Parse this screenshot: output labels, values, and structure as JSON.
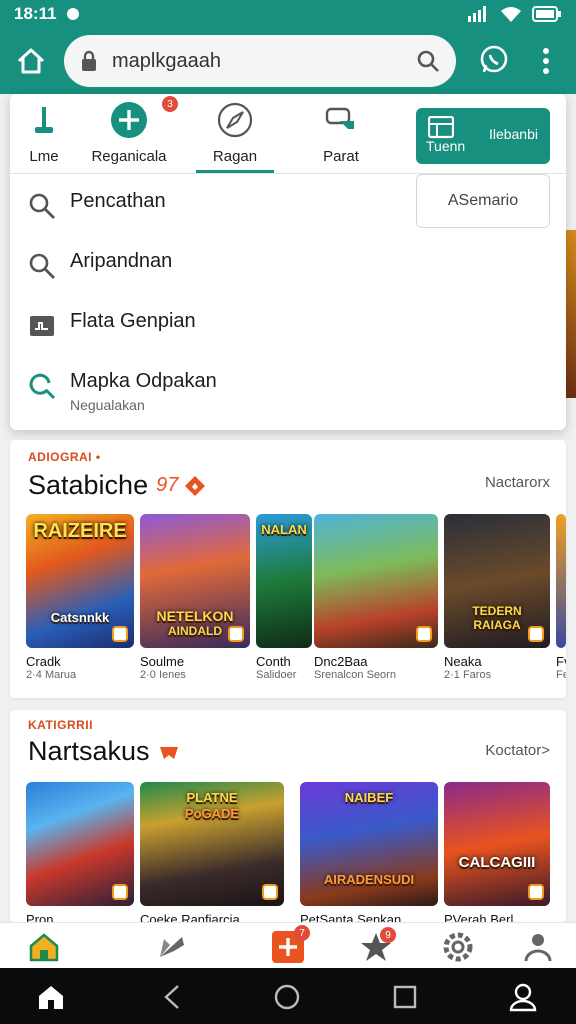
{
  "status": {
    "time": "18:11"
  },
  "url": {
    "value": "maplkgaaah"
  },
  "tabs": [
    {
      "label": "Lme"
    },
    {
      "label": "Reganicala",
      "badge": "3"
    },
    {
      "label": "Ragan"
    },
    {
      "label": "Parat"
    }
  ],
  "theme_button": {
    "left": "Tuenn",
    "right": "Ilebanbi"
  },
  "semario_button": "ASemario",
  "suggestions": [
    {
      "text": "Pencathan",
      "icon": "search-icon"
    },
    {
      "text": "Aripandnan",
      "icon": "search-icon"
    },
    {
      "text": "Flata Genpian",
      "icon": "document-icon"
    },
    {
      "text": "Mapka Odpakan",
      "sub": "Negualakan",
      "icon": "search-refresh-icon"
    }
  ],
  "sections": [
    {
      "kicker": "ADIOGRAI •",
      "title": "Satabiche",
      "title_badge": "97",
      "link": "Nactarorx",
      "cards": [
        {
          "art": "RAIZEIRE",
          "art2": "Catsnnkk",
          "name": "Cradk",
          "meta": "2·4 Marua"
        },
        {
          "art": "NETELKON",
          "art2": "AINDALD",
          "name": "Soulme",
          "meta": "2·0 Ienes"
        },
        {
          "art": "NALAN",
          "art2": "",
          "name": "Conth",
          "meta": "Salidoer"
        },
        {
          "art": "",
          "art2": "",
          "name": "Dnc2Baa",
          "meta": "Srenalcon Seorn"
        },
        {
          "art": "TEDERN",
          "art2": "RAIAGA",
          "name": "Neaka",
          "meta": "2·1 Faros"
        },
        {
          "art": "",
          "art2": "",
          "name": "Fv",
          "meta": "Fe"
        }
      ]
    },
    {
      "kicker": "KATIGRRII",
      "title": "Nartsakus",
      "link": "Koctator>",
      "cards": [
        {
          "art": "",
          "art2": "",
          "name": "Pron",
          "meta": ""
        },
        {
          "art": "PLATNE",
          "art2": "PoGADE",
          "name": "Coeke Ranfiarcia",
          "meta": ""
        },
        {
          "art": "NAIBEF",
          "art2": "AIRADENSUDI",
          "name": "PetSanta Senkan",
          "meta": ""
        },
        {
          "art": "CALCAGIII",
          "art2": "",
          "name": "PVerah Berl",
          "meta": ""
        }
      ]
    }
  ],
  "bottom_nav": {
    "add_badge": "7",
    "star_badge": "9"
  },
  "colors": {
    "primary": "#17907f",
    "accent": "#e8531f",
    "badge": "#e24b3b"
  }
}
